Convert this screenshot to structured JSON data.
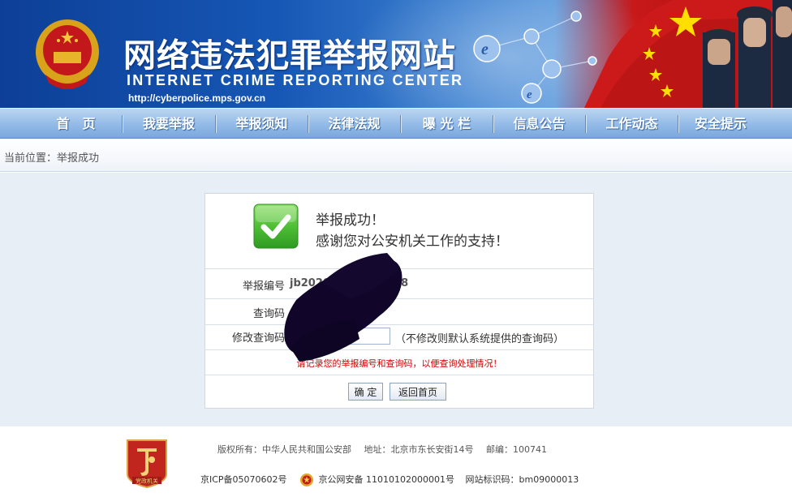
{
  "header": {
    "title_cn": "网络违法犯罪举报网站",
    "title_en": "INTERNET CRIME REPORTING CENTER",
    "url": "http://cyberpolice.mps.gov.cn"
  },
  "nav": {
    "items": [
      {
        "label": "首　页"
      },
      {
        "label": "我要举报"
      },
      {
        "label": "举报须知"
      },
      {
        "label": "法律法规"
      },
      {
        "label": "曝 光 栏"
      },
      {
        "label": "信息公告"
      },
      {
        "label": "工作动态"
      },
      {
        "label": "安全提示"
      }
    ]
  },
  "breadcrumb": {
    "text": "当前位置：举报成功"
  },
  "result": {
    "line1": "举报成功！",
    "line2": "感谢您对公安机关工作的支持！",
    "report_no_label": "举报编号",
    "report_no_value": "jb2020",
    "report_no_tail": "0648",
    "query_code_label": "查询码",
    "change_code_label": "修改查询码",
    "change_code_hint": "（不修改则默认系统提供的查询码）",
    "change_code_value": "",
    "warning": "请记录您的举报编号和查询码，以便查询处理情况！",
    "confirm_label": "确 定",
    "home_label": "返回首页"
  },
  "footer": {
    "copyright": "版权所有：中华人民共和国公安部",
    "address": "地址：北京市东长安街14号",
    "postcode": "邮编：100741",
    "icp": "京ICP备05070602号",
    "police_record": "京公网安备 11010102000001号",
    "site_id": "网站标识码：bm09000013",
    "badge_text": "党政机关"
  },
  "colors": {
    "banner_blue": "#1657b5",
    "flag_red": "#c81818",
    "warning_red": "#d10000",
    "success_green": "#3faa2c"
  }
}
